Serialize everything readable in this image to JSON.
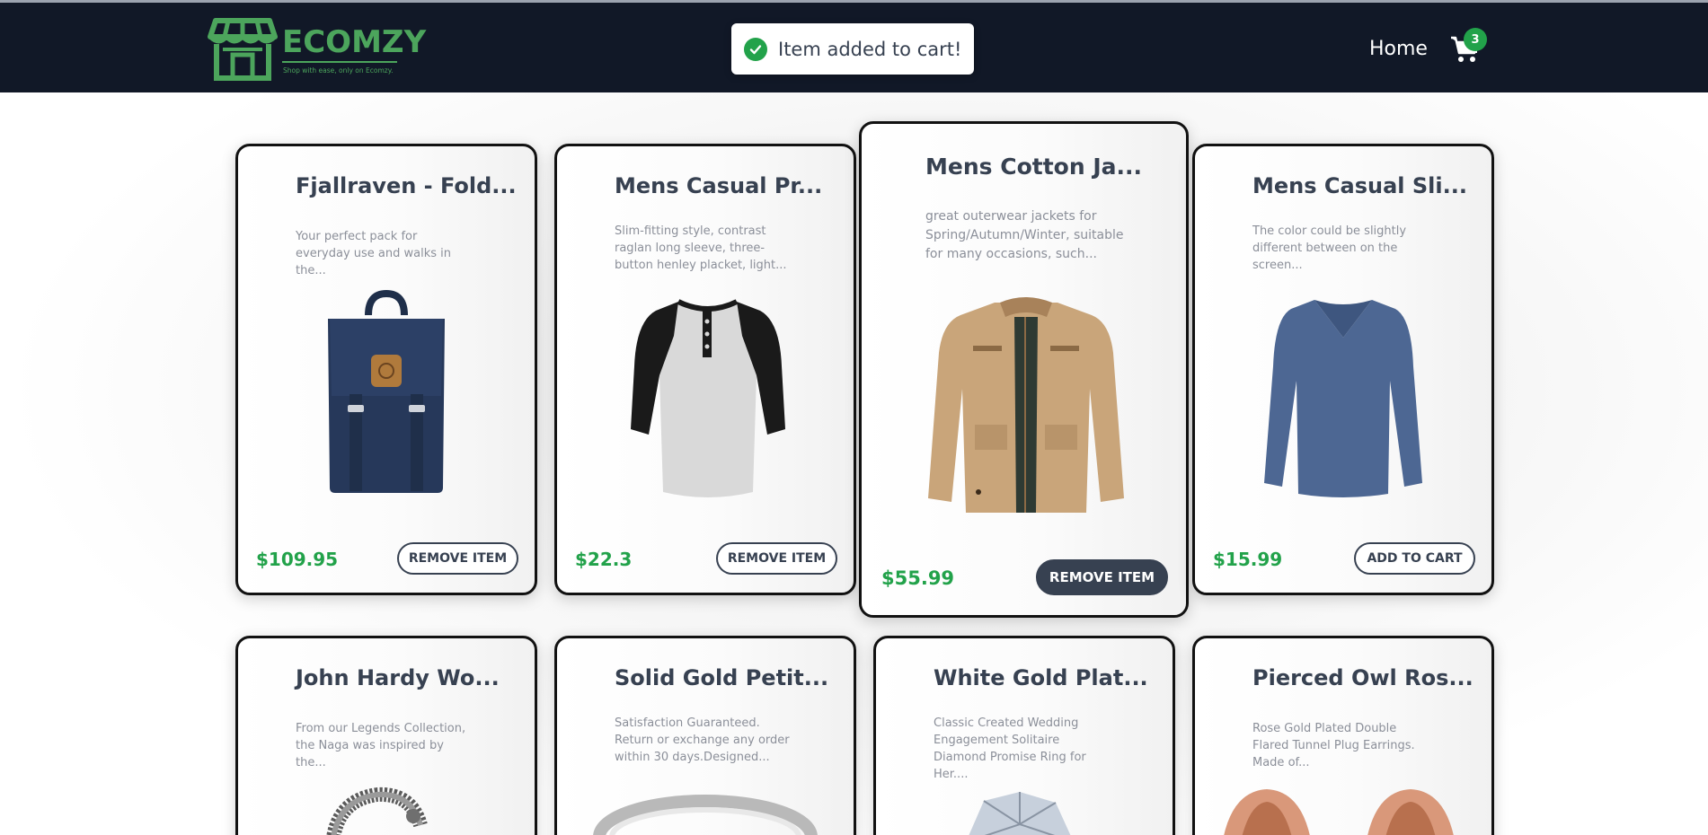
{
  "brand": {
    "name": "ECOMZY",
    "tagline": "Shop with ease, only on Ecomzy."
  },
  "toast": {
    "message": "Item added to cart!",
    "icon": "check-circle-icon",
    "color": "#22a24a"
  },
  "nav": {
    "home": "Home",
    "cart_count": "3",
    "cart_icon": "shopping-cart-icon"
  },
  "colors": {
    "navbar": "#111827",
    "accent": "#22a24a",
    "text": "#374151"
  },
  "products": [
    {
      "title": "Fjallraven - Fold...",
      "desc": "Your perfect pack for everyday use and walks in the...",
      "price": "$109.95",
      "button": "REMOVE ITEM",
      "image": "backpack"
    },
    {
      "title": "Mens Casual Pr...",
      "desc": "Slim-fitting style, contrast raglan long sleeve, three-button henley placket, light...",
      "price": "$22.3",
      "button": "REMOVE ITEM",
      "image": "henley-shirt"
    },
    {
      "title": "Mens Cotton Ja...",
      "desc": "great outerwear jackets for Spring/Autumn/Winter, suitable for many occasions, such...",
      "price": "$55.99",
      "button": "REMOVE ITEM",
      "image": "cotton-jacket"
    },
    {
      "title": "Mens Casual Sli...",
      "desc": "The color could be slightly different between on the screen...",
      "price": "$15.99",
      "button": "ADD TO CART",
      "image": "long-sleeve-shirt"
    },
    {
      "title": "John Hardy Wo...",
      "desc": "From our Legends Collection, the Naga was inspired by the...",
      "image": "dragon-bracelet"
    },
    {
      "title": "Solid Gold Petit...",
      "desc": "Satisfaction Guaranteed. Return or exchange any order within 30 days.Designed...",
      "image": "gold-ring"
    },
    {
      "title": "White Gold Plat...",
      "desc": "Classic Created Wedding Engagement Solitaire Diamond Promise Ring for Her....",
      "image": "diamond-ring"
    },
    {
      "title": "Pierced Owl Ros...",
      "desc": "Rose Gold Plated Double Flared Tunnel Plug Earrings. Made of...",
      "image": "tunnel-plugs"
    }
  ]
}
